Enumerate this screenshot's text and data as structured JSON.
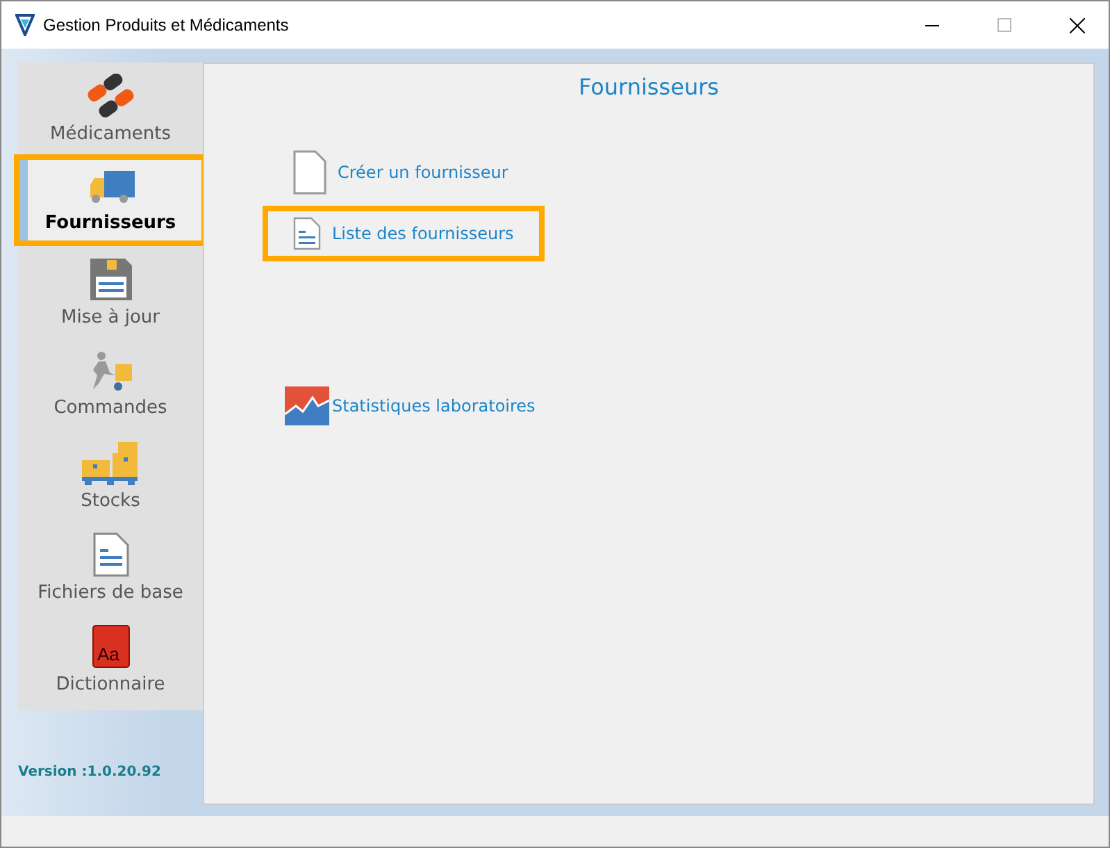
{
  "window": {
    "title": "Gestion Produits et Médicaments"
  },
  "sidebar": {
    "items": [
      {
        "label": "Médicaments",
        "kind": "pills",
        "selected": false
      },
      {
        "label": "Fournisseurs",
        "kind": "truck",
        "selected": true
      },
      {
        "label": "Mise à jour",
        "kind": "floppy",
        "selected": false
      },
      {
        "label": "Commandes",
        "kind": "courier",
        "selected": false
      },
      {
        "label": "Stocks",
        "kind": "boxes",
        "selected": false
      },
      {
        "label": "Fichiers de base",
        "kind": "document",
        "selected": false
      },
      {
        "label": "Dictionnaire",
        "kind": "dictionary",
        "icon_text": "Aa",
        "selected": false
      }
    ],
    "version": "Version :1.0.20.92"
  },
  "content": {
    "title": "Fournisseurs",
    "actions": [
      {
        "label": "Créer un fournisseur",
        "kind": "new-file",
        "selected": false
      },
      {
        "label": "Liste des fournisseurs",
        "kind": "list-file",
        "selected": true
      },
      {
        "label": "Statistiques laboratoires",
        "kind": "chart",
        "selected": false
      }
    ]
  }
}
